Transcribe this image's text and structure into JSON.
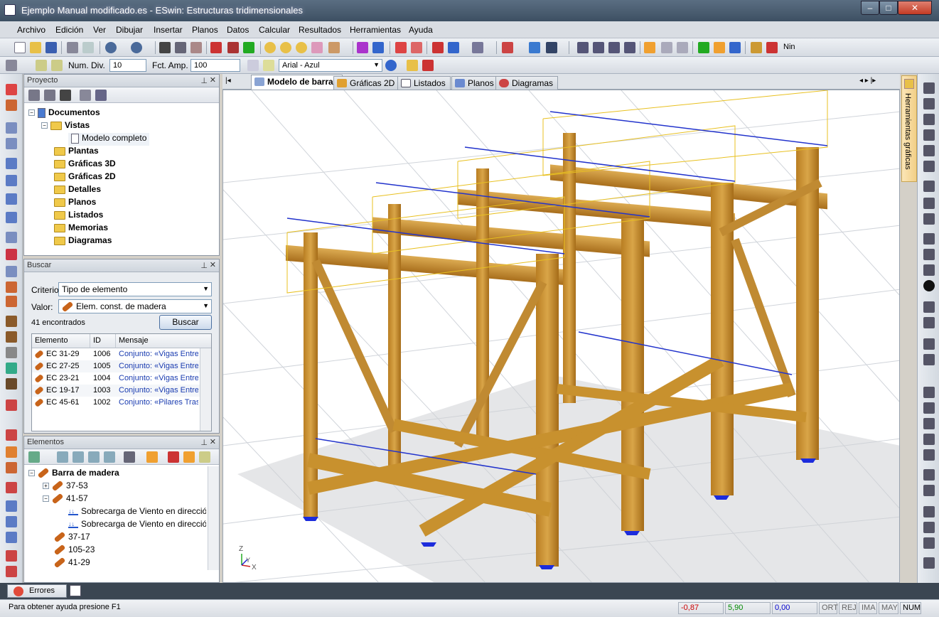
{
  "window": {
    "title": "Ejemplo Manual modificado.es - ESwin: Estructuras tridimensionales",
    "minimize": "–",
    "maximize": "□",
    "close": "✕"
  },
  "menu": [
    "Archivo",
    "Edición",
    "Ver",
    "Dibujar",
    "Insertar",
    "Planos",
    "Datos",
    "Calcular",
    "Resultados",
    "Herramientas",
    "Ayuda"
  ],
  "toolbar2": {
    "num_div_label": "Num. Div.",
    "num_div_value": "10",
    "fct_amp_label": "Fct. Amp.",
    "fct_amp_value": "100",
    "font_value": "Arial - Azul",
    "nin_label": "Nin"
  },
  "tabs": {
    "modelo": "Modelo de barras",
    "graficas2d": "Gráficas 2D",
    "listados": "Listados",
    "planos": "Planos",
    "diagramas": "Diagramas"
  },
  "proyecto": {
    "title": "Proyecto",
    "pin": "⊥",
    "close": "✕",
    "tree": {
      "documentos": "Documentos",
      "vistas": "Vistas",
      "modelo_completo": "Modelo completo",
      "plantas": "Plantas",
      "graficas3d": "Gráficas 3D",
      "graficas2d": "Gráficas 2D",
      "detalles": "Detalles",
      "planos": "Planos",
      "listados": "Listados",
      "memorias": "Memorias",
      "diagramas": "Diagramas"
    }
  },
  "buscar": {
    "title": "Buscar",
    "pin": "⊥",
    "close": "✕",
    "criterio_label": "Criterio:",
    "criterio_value": "Tipo de elemento",
    "valor_label": "Valor:",
    "valor_value": "Elem. const. de madera",
    "found": "41 encontrados",
    "button": "Buscar",
    "headers": {
      "elemento": "Elemento",
      "id": "ID",
      "mensaje": "Mensaje"
    },
    "rows": [
      {
        "elemento": "EC 31-29",
        "id": "1006",
        "mensaje": "Conjunto: «Vigas Entrep"
      },
      {
        "elemento": "EC 27-25",
        "id": "1005",
        "mensaje": "Conjunto: «Vigas Entrep"
      },
      {
        "elemento": "EC 23-21",
        "id": "1004",
        "mensaje": "Conjunto: «Vigas Entrep"
      },
      {
        "elemento": "EC 19-17",
        "id": "1003",
        "mensaje": "Conjunto: «Vigas Entrep"
      },
      {
        "elemento": "EC 45-61",
        "id": "1002",
        "mensaje": "Conjunto: «Pilares Tras"
      }
    ]
  },
  "elementos": {
    "title": "Elementos",
    "pin": "⊥",
    "close": "✕",
    "tree": {
      "root": "Barra de madera",
      "n1": "37-53",
      "n2": "41-57",
      "load1": "Sobrecarga de Viento en dirección",
      "load2": "Sobrecarga de Viento en dirección",
      "n3": "37-17",
      "n4": "105-23",
      "n5": "41-29"
    }
  },
  "right_panel_tab": "Herramientas gráficas",
  "errors_tab": "Errores",
  "status": {
    "help": "Para obtener ayuda presione F1",
    "x": "-0,87",
    "y": "5,90",
    "z": "0,00",
    "ort": "ORT",
    "rej": "REJ",
    "ima": "IMA",
    "may": "MAY",
    "num": "NUM"
  },
  "axes": {
    "z": "Z",
    "y": "Y",
    "x": "X"
  },
  "colors": {
    "wood": "#c8902e",
    "wood_dark": "#9a6a1c",
    "load_blue": "#2233cc",
    "load_yellow": "#e8c020",
    "support": "#1c2cdc"
  }
}
